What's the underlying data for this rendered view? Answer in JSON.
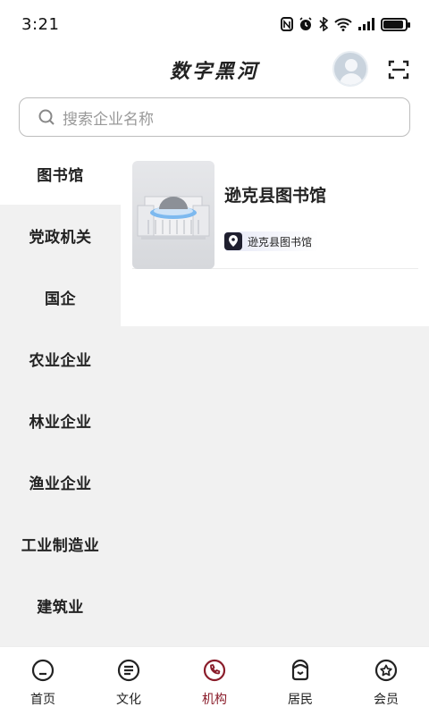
{
  "status_bar": {
    "time": "3:21"
  },
  "header": {
    "title": "数字黑河"
  },
  "search": {
    "placeholder": "搜索企业名称"
  },
  "categories": [
    {
      "label": "图书馆",
      "active": true
    },
    {
      "label": "党政机关"
    },
    {
      "label": "国企"
    },
    {
      "label": "农业企业"
    },
    {
      "label": "林业企业"
    },
    {
      "label": "渔业企业"
    },
    {
      "label": "工业制造业"
    },
    {
      "label": "建筑业"
    }
  ],
  "results": [
    {
      "name": "逊克县图书馆",
      "tag": "逊克县图书馆"
    }
  ],
  "nav": [
    {
      "label": "首页"
    },
    {
      "label": "文化"
    },
    {
      "label": "机构",
      "active": true
    },
    {
      "label": "居民"
    },
    {
      "label": "会员"
    }
  ],
  "colors": {
    "accent": "#8a1c2a",
    "inactive": "#222222",
    "panel_bg": "#f1f1f1"
  }
}
